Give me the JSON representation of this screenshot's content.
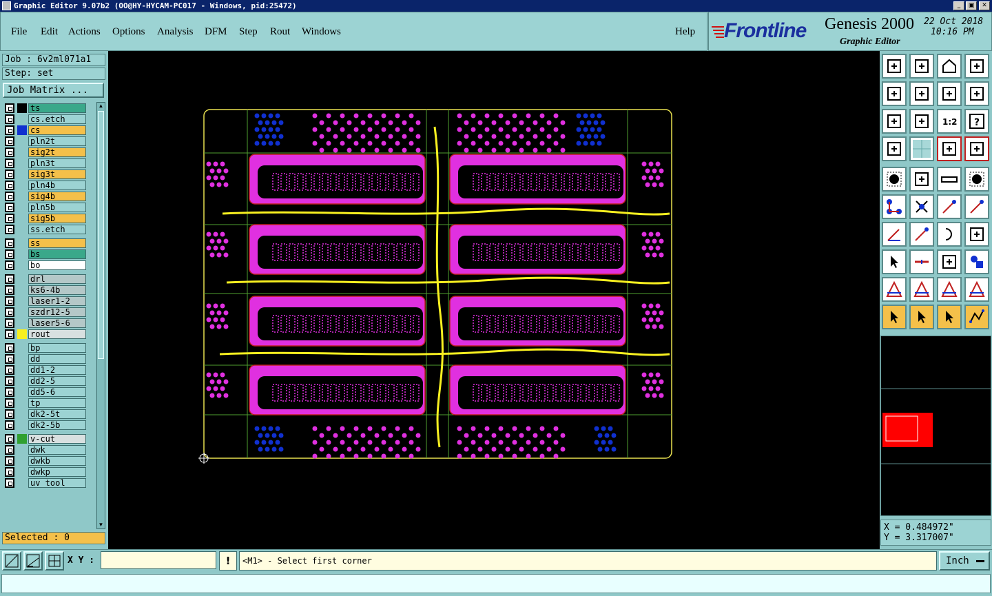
{
  "window": {
    "title": "Graphic Editor 9.07b2 (OO@HY-HYCAM-PC017 - Windows, pid:25472)"
  },
  "menu": {
    "items": [
      "File",
      "Edit",
      "Actions",
      "Options",
      "Analysis",
      "DFM",
      "Step",
      "Rout",
      "Windows"
    ],
    "help": "Help"
  },
  "brand": {
    "logo": "Frontline",
    "product": "Genesis 2000",
    "subtitle": "Graphic Editor",
    "date": "22 Oct 2018",
    "time": "10:16 PM"
  },
  "job": {
    "job_label": "Job : 6v2ml071a1",
    "step_label": "Step: set",
    "matrix_button": "Job Matrix ..."
  },
  "layers": [
    {
      "name": "ts",
      "bg": "#3aa88a",
      "color": "#000000"
    },
    {
      "name": "cs.etch",
      "bg": "#9cd3d3",
      "color": ""
    },
    {
      "name": "cs",
      "bg": "#f4c04a",
      "color": "#1030d0"
    },
    {
      "name": "pln2t",
      "bg": "#9cd3d3",
      "color": ""
    },
    {
      "name": "sig2t",
      "bg": "#f4c04a",
      "color": ""
    },
    {
      "name": "pln3t",
      "bg": "#9cd3d3",
      "color": ""
    },
    {
      "name": "sig3t",
      "bg": "#f4c04a",
      "color": ""
    },
    {
      "name": "pln4b",
      "bg": "#9cd3d3",
      "color": ""
    },
    {
      "name": "sig4b",
      "bg": "#f4c04a",
      "color": ""
    },
    {
      "name": "pln5b",
      "bg": "#9cd3d3",
      "color": ""
    },
    {
      "name": "sig5b",
      "bg": "#f4c04a",
      "color": ""
    },
    {
      "name": "ss.etch",
      "bg": "#9cd3d3",
      "color": ""
    },
    {
      "name": "ss",
      "bg": "#f4c04a",
      "color": ""
    },
    {
      "name": "bs",
      "bg": "#3aa88a",
      "color": ""
    },
    {
      "name": "bo",
      "bg": "#ffffff",
      "color": ""
    },
    {
      "name": "drl",
      "bg": "#b4c8c8",
      "color": ""
    },
    {
      "name": "ks6-4b",
      "bg": "#b4c8c8",
      "color": ""
    },
    {
      "name": "laser1-2",
      "bg": "#b4c8c8",
      "color": ""
    },
    {
      "name": "szdr12-5",
      "bg": "#b4c8c8",
      "color": ""
    },
    {
      "name": "laser5-6",
      "bg": "#b4c8c8",
      "color": ""
    },
    {
      "name": "rout",
      "bg": "#d8e0e0",
      "color": "#f8f020"
    },
    {
      "name": "bp",
      "bg": "#9cd3d3",
      "color": ""
    },
    {
      "name": "dd",
      "bg": "#9cd3d3",
      "color": ""
    },
    {
      "name": "dd1-2",
      "bg": "#9cd3d3",
      "color": ""
    },
    {
      "name": "dd2-5",
      "bg": "#9cd3d3",
      "color": ""
    },
    {
      "name": "dd5-6",
      "bg": "#9cd3d3",
      "color": ""
    },
    {
      "name": "tp",
      "bg": "#9cd3d3",
      "color": ""
    },
    {
      "name": "dk2-5t",
      "bg": "#9cd3d3",
      "color": ""
    },
    {
      "name": "dk2-5b",
      "bg": "#9cd3d3",
      "color": ""
    },
    {
      "name": "v-cut",
      "bg": "#d8e0e0",
      "color": "#30a030"
    },
    {
      "name": "dwk",
      "bg": "#9cd3d3",
      "color": ""
    },
    {
      "name": "dwkb",
      "bg": "#9cd3d3",
      "color": ""
    },
    {
      "name": "dwkp",
      "bg": "#9cd3d3",
      "color": ""
    },
    {
      "name": "uv tool",
      "bg": "#9cd3d3",
      "color": ""
    }
  ],
  "selected_label": "Selected : 0",
  "coords": {
    "x": "X = 0.484972\"",
    "y": "Y = 3.317007\""
  },
  "bottom": {
    "xy_label": "X Y :",
    "xy_value": "",
    "bang": "!",
    "prompt": "<M1> - Select first corner",
    "units": "Inch"
  },
  "colors": {
    "canvas": "#000000",
    "profile": "#e8e050",
    "pads": "#e030e0",
    "blue_pads": "#1030d0",
    "outline": "#50a030",
    "rout": "#f8f020",
    "panel": "#8fc8c8"
  }
}
